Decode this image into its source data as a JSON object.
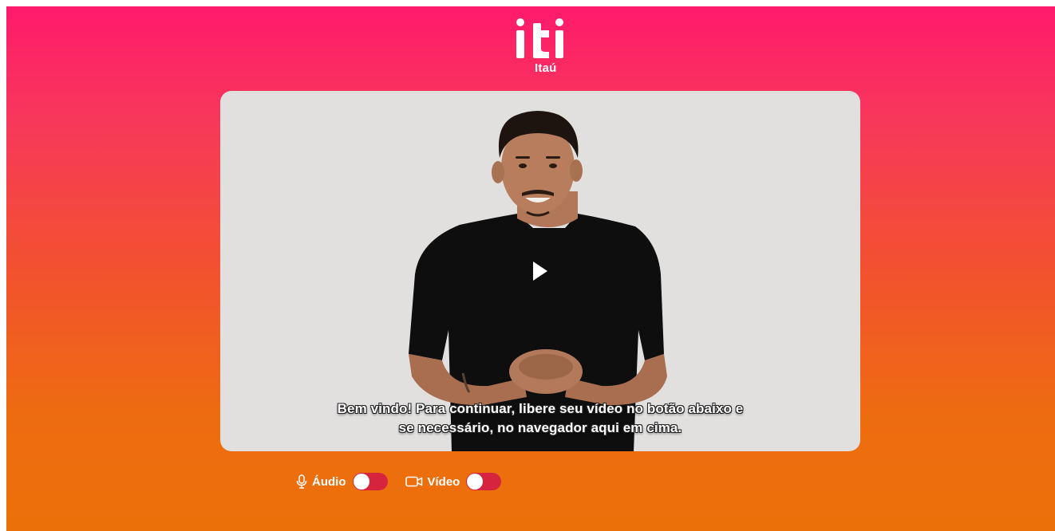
{
  "brand": {
    "logo_text": "iti",
    "sub_text": "Itaú"
  },
  "video": {
    "caption_line1": "Bem vindo! Para continuar, libere seu vídeo no botão abaixo e",
    "caption_line2": "se necessário, no navegador aqui em cima.",
    "state": "paused"
  },
  "controls": {
    "audio": {
      "label": "Áudio",
      "icon": "microphone-icon",
      "enabled": false
    },
    "video": {
      "label": "Vídeo",
      "icon": "camera-icon",
      "enabled": false
    }
  },
  "colors": {
    "gradient_top": "#ff1a6c",
    "gradient_bottom": "#ec700a",
    "toggle_off": "#d6233e",
    "player_bg": "#e2e0df"
  }
}
